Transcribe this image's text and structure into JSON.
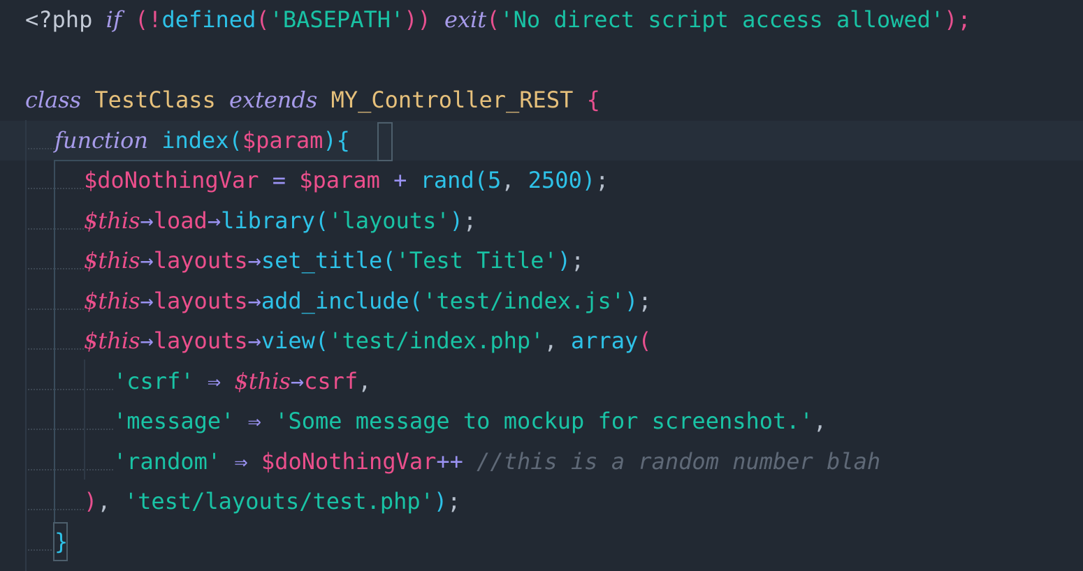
{
  "editor": {
    "colors": {
      "background": "#222933",
      "current_line": "#262f3a",
      "keyword": "#a79bea",
      "variable": "#ec4f8c",
      "function": "#2ec2e8",
      "string": "#19c3a5",
      "class_name": "#e6c07b",
      "comment": "#5f6977"
    },
    "lines": [
      {
        "indent": 0,
        "tokens": [
          {
            "t": "<?php ",
            "c": "tag"
          },
          {
            "t": "if",
            "c": "kw"
          },
          {
            "t": " ",
            "c": "punc"
          },
          {
            "t": "(!",
            "c": "paren"
          },
          {
            "t": "defined",
            "c": "fn"
          },
          {
            "t": "(",
            "c": "paren"
          },
          {
            "t": "'BASEPATH'",
            "c": "str"
          },
          {
            "t": "))",
            "c": "paren"
          },
          {
            "t": " ",
            "c": "punc"
          },
          {
            "t": "exit",
            "c": "kw"
          },
          {
            "t": "(",
            "c": "paren"
          },
          {
            "t": "'No direct script access allowed'",
            "c": "str"
          },
          {
            "t": ");",
            "c": "paren"
          }
        ]
      },
      {
        "indent": 0,
        "tokens": []
      },
      {
        "indent": 0,
        "tokens": [
          {
            "t": "class",
            "c": "kw"
          },
          {
            "t": " ",
            "c": "punc"
          },
          {
            "t": "TestClass",
            "c": "cls"
          },
          {
            "t": " ",
            "c": "punc"
          },
          {
            "t": "extends",
            "c": "kw"
          },
          {
            "t": " ",
            "c": "punc"
          },
          {
            "t": "MY_Controller_REST",
            "c": "cls"
          },
          {
            "t": " ",
            "c": "punc"
          },
          {
            "t": "{",
            "c": "paren"
          }
        ]
      },
      {
        "indent": 1,
        "current": true,
        "tokens": [
          {
            "t": "function",
            "c": "kw"
          },
          {
            "t": " ",
            "c": "punc"
          },
          {
            "t": "index",
            "c": "fn"
          },
          {
            "t": "(",
            "c": "fn"
          },
          {
            "t": "$param",
            "c": "var"
          },
          {
            "t": ")",
            "c": "fn"
          },
          {
            "t": "{",
            "c": "fn"
          }
        ]
      },
      {
        "indent": 2,
        "tokens": [
          {
            "t": "$doNothingVar",
            "c": "var"
          },
          {
            "t": " = ",
            "c": "op"
          },
          {
            "t": "$param",
            "c": "var"
          },
          {
            "t": " + ",
            "c": "op"
          },
          {
            "t": "rand",
            "c": "fn"
          },
          {
            "t": "(",
            "c": "fn"
          },
          {
            "t": "5",
            "c": "num"
          },
          {
            "t": ", ",
            "c": "punc"
          },
          {
            "t": "2500",
            "c": "num"
          },
          {
            "t": ")",
            "c": "fn"
          },
          {
            "t": ";",
            "c": "punc"
          }
        ]
      },
      {
        "indent": 2,
        "tokens": [
          {
            "t": "$this",
            "c": "this"
          },
          {
            "t": "→",
            "c": "op"
          },
          {
            "t": "load",
            "c": "var"
          },
          {
            "t": "→",
            "c": "op"
          },
          {
            "t": "library",
            "c": "fn"
          },
          {
            "t": "(",
            "c": "fn"
          },
          {
            "t": "'layouts'",
            "c": "str"
          },
          {
            "t": ")",
            "c": "fn"
          },
          {
            "t": ";",
            "c": "punc"
          }
        ]
      },
      {
        "indent": 2,
        "tokens": [
          {
            "t": "$this",
            "c": "this"
          },
          {
            "t": "→",
            "c": "op"
          },
          {
            "t": "layouts",
            "c": "var"
          },
          {
            "t": "→",
            "c": "op"
          },
          {
            "t": "set_title",
            "c": "fn"
          },
          {
            "t": "(",
            "c": "fn"
          },
          {
            "t": "'Test Title'",
            "c": "str"
          },
          {
            "t": ")",
            "c": "fn"
          },
          {
            "t": ";",
            "c": "punc"
          }
        ]
      },
      {
        "indent": 2,
        "tokens": [
          {
            "t": "$this",
            "c": "this"
          },
          {
            "t": "→",
            "c": "op"
          },
          {
            "t": "layouts",
            "c": "var"
          },
          {
            "t": "→",
            "c": "op"
          },
          {
            "t": "add_include",
            "c": "fn"
          },
          {
            "t": "(",
            "c": "fn"
          },
          {
            "t": "'test/index.js'",
            "c": "str"
          },
          {
            "t": ")",
            "c": "fn"
          },
          {
            "t": ";",
            "c": "punc"
          }
        ]
      },
      {
        "indent": 2,
        "tokens": [
          {
            "t": "$this",
            "c": "this"
          },
          {
            "t": "→",
            "c": "op"
          },
          {
            "t": "layouts",
            "c": "var"
          },
          {
            "t": "→",
            "c": "op"
          },
          {
            "t": "view",
            "c": "fn"
          },
          {
            "t": "(",
            "c": "fn"
          },
          {
            "t": "'test/index.php'",
            "c": "str"
          },
          {
            "t": ", ",
            "c": "punc"
          },
          {
            "t": "array",
            "c": "fn"
          },
          {
            "t": "(",
            "c": "paren"
          }
        ]
      },
      {
        "indent": 3,
        "tokens": [
          {
            "t": "'csrf'",
            "c": "str"
          },
          {
            "t": " ⇒ ",
            "c": "op"
          },
          {
            "t": "$this",
            "c": "this"
          },
          {
            "t": "→",
            "c": "op"
          },
          {
            "t": "csrf",
            "c": "var"
          },
          {
            "t": ",",
            "c": "punc"
          }
        ]
      },
      {
        "indent": 3,
        "tokens": [
          {
            "t": "'message'",
            "c": "str"
          },
          {
            "t": " ⇒ ",
            "c": "op"
          },
          {
            "t": "'Some message to mockup for screenshot.'",
            "c": "str"
          },
          {
            "t": ",",
            "c": "punc"
          }
        ]
      },
      {
        "indent": 3,
        "tokens": [
          {
            "t": "'random'",
            "c": "str"
          },
          {
            "t": " ⇒ ",
            "c": "op"
          },
          {
            "t": "$doNothingVar",
            "c": "var"
          },
          {
            "t": "++",
            "c": "op"
          },
          {
            "t": " ",
            "c": "punc"
          },
          {
            "t": "//this is a random number blah",
            "c": "cmt"
          }
        ]
      },
      {
        "indent": 2,
        "tokens": [
          {
            "t": ")",
            "c": "paren"
          },
          {
            "t": ", ",
            "c": "punc"
          },
          {
            "t": "'test/layouts/test.php'",
            "c": "str"
          },
          {
            "t": ")",
            "c": "fn"
          },
          {
            "t": ";",
            "c": "punc"
          }
        ]
      },
      {
        "indent": 1,
        "tokens": [
          {
            "t": "}",
            "c": "fn"
          }
        ]
      }
    ]
  }
}
